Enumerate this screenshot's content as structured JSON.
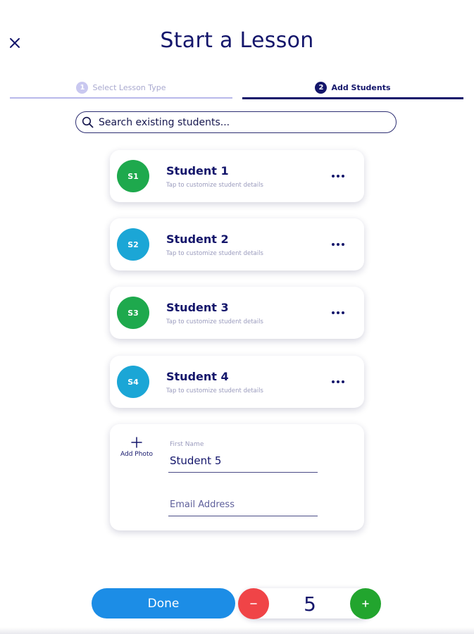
{
  "header": {
    "title": "Start a Lesson"
  },
  "steps": [
    {
      "number": "1",
      "label": "Select Lesson Type",
      "active": false
    },
    {
      "number": "2",
      "label": "Add Students",
      "active": true
    }
  ],
  "search": {
    "placeholder": "Search existing students..."
  },
  "students": [
    {
      "initials": "S1",
      "name": "Student 1",
      "subtitle": "Tap to customize student details",
      "color": "#1ea94d"
    },
    {
      "initials": "S2",
      "name": "Student 2",
      "subtitle": "Tap to customize student details",
      "color": "#1ba6d6"
    },
    {
      "initials": "S3",
      "name": "Student 3",
      "subtitle": "Tap to customize student details",
      "color": "#1ea94d"
    },
    {
      "initials": "S4",
      "name": "Student 4",
      "subtitle": "Tap to customize student details",
      "color": "#1ba6d6"
    }
  ],
  "new_student": {
    "add_photo_label": "Add Photo",
    "first_name_caption": "First Name",
    "first_name_value": "Student 5",
    "email_placeholder": "Email Address"
  },
  "footer": {
    "done_label": "Done",
    "count": "5"
  },
  "colors": {
    "primary": "#14166b",
    "done": "#1c8de6",
    "minus": "#f04447",
    "plus": "#22a52e"
  }
}
